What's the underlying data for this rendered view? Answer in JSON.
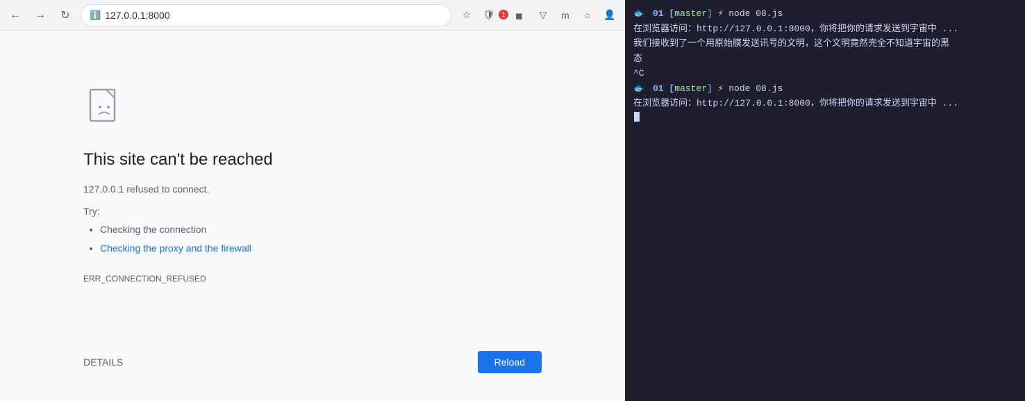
{
  "browser": {
    "address": "127.0.0.1:8000",
    "address_icon": "ℹ",
    "reload_icon": "↻"
  },
  "error_page": {
    "title": "This site can't be reached",
    "subtitle": "127.0.0.1 refused to connect.",
    "try_label": "Try:",
    "suggestions": [
      {
        "text": "Checking the connection",
        "is_link": false
      },
      {
        "text": "Checking the proxy and the firewall",
        "is_link": true
      }
    ],
    "error_code": "ERR_CONNECTION_REFUSED",
    "details_label": "DETAILS",
    "reload_label": "Reload"
  },
  "terminal": {
    "lines": [
      {
        "type": "prompt",
        "num": "01",
        "branch": "master",
        "bolt": "⚡",
        "cmd": "node 08.js"
      },
      {
        "type": "output",
        "text": "在浏览器访问：http://127.0.0.1:8000，你将把你的请求发送到宇宙中 ..."
      },
      {
        "type": "output",
        "text": "我们接收到了一个用原始膜发送讯号的文明，这个文明竟然完全不知道宇宙的黑态"
      },
      {
        "type": "ctrl",
        "text": "^C"
      },
      {
        "type": "prompt",
        "num": "01",
        "branch": "master",
        "bolt": "⚡",
        "cmd": "node 08.js"
      },
      {
        "type": "output",
        "text": "在浏览器访问：http://127.0.0.1:8000，你将把你的请求发送到宇宙中 ..."
      }
    ]
  }
}
